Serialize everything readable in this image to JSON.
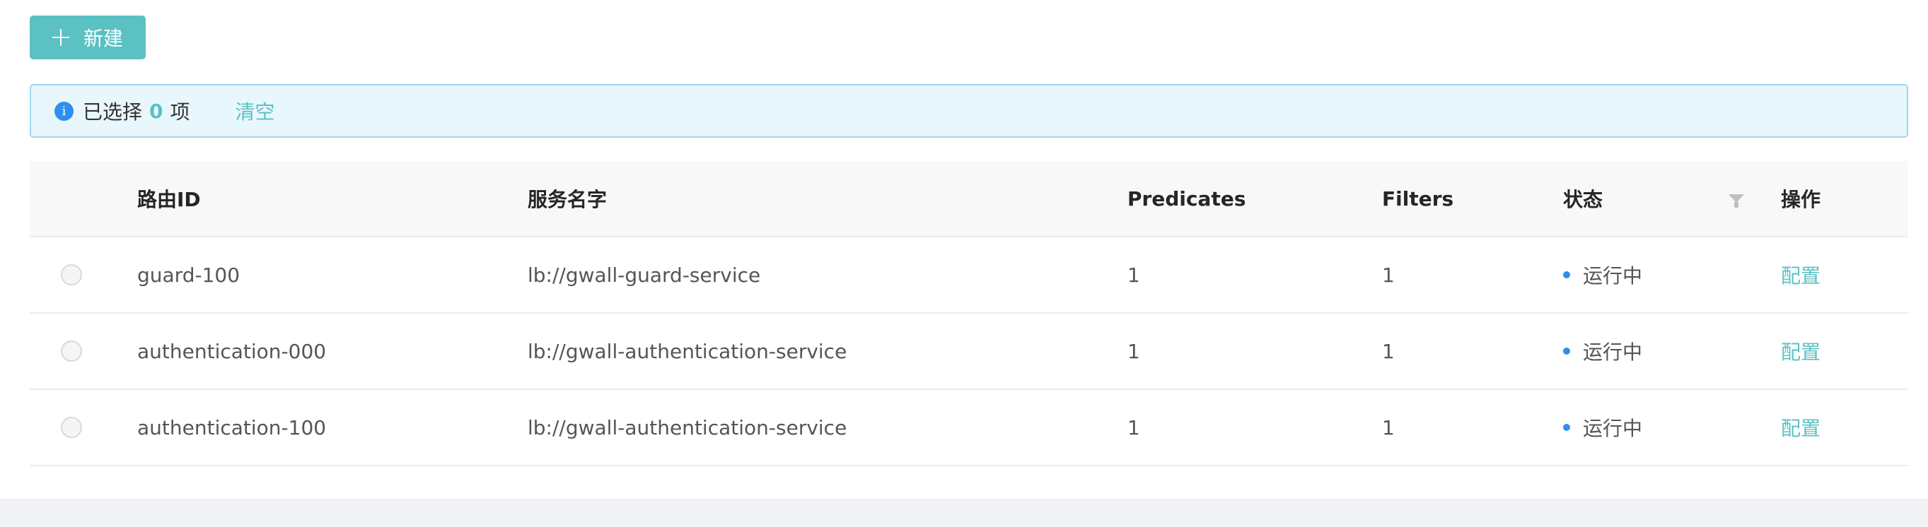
{
  "toolbar": {
    "new_label": "新建"
  },
  "selection_alert": {
    "prefix": "已选择",
    "count": "0",
    "suffix": "项",
    "clear_label": "清空"
  },
  "table": {
    "columns": {
      "route_id": "路由ID",
      "service_name": "服务名字",
      "predicates": "Predicates",
      "filters": "Filters",
      "status": "状态",
      "actions": "操作"
    },
    "rows": [
      {
        "route_id": "guard-100",
        "service_name": "lb://gwall-guard-service",
        "predicates": "1",
        "filters": "1",
        "status": "运行中",
        "action": "配置"
      },
      {
        "route_id": "authentication-000",
        "service_name": "lb://gwall-authentication-service",
        "predicates": "1",
        "filters": "1",
        "status": "运行中",
        "action": "配置"
      },
      {
        "route_id": "authentication-100",
        "service_name": "lb://gwall-authentication-service",
        "predicates": "1",
        "filters": "1",
        "status": "运行中",
        "action": "配置"
      }
    ]
  },
  "icons": {
    "add": "plus-icon",
    "info": "info-icon",
    "status_filter": "funnel-icon"
  },
  "colors": {
    "primary": "#5bc1c3",
    "info_blue": "#2f8ef0",
    "alert_bg": "#e8f7fc",
    "alert_border": "#9fd7ee"
  }
}
